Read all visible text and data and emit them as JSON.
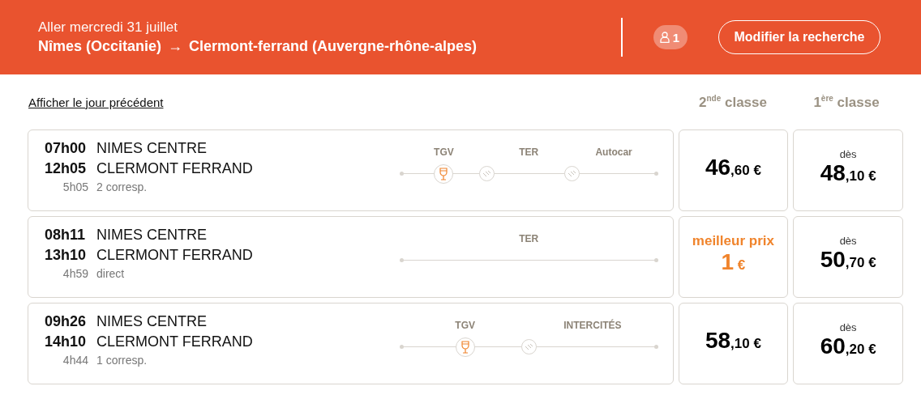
{
  "header": {
    "date": "Aller mercredi 31 juillet",
    "origin": "Nîmes (Occitanie)",
    "arrow": "→",
    "destination": "Clermont-ferrand (Auvergne-rhône-alpes)",
    "passengers": "1",
    "button": "Modifier la recherche"
  },
  "previous_day_link": "Afficher le jour précédent",
  "classes": [
    {
      "label": "2$^{nde}$ classe"
    },
    {
      "label": "1$^{ère}$ classe"
    }
  ],
  "trains": [
    {
      "departure": "07h00",
      "arrival": "12h05",
      "duration": "5h05",
      "origin": "NIMES CENTRE",
      "destination": "CLERMONT FERRAND",
      "connections": "2 corresp.",
      "segments": [
        {
          "label": "TGV",
          "bar_car": true
        },
        {
          "label": "TER",
          "bar_car": false
        },
        {
          "label": "Autocar",
          "bar_car": false
        }
      ],
      "prices": [
        {
          "best": false,
          "whole": "46",
          "fraction": ",60 €"
        },
        {
          "best": false,
          "from": "dès",
          "whole": "48",
          "fraction": ",10 €"
        }
      ]
    },
    {
      "departure": "08h11",
      "arrival": "13h10",
      "duration": "4h59",
      "origin": "NIMES CENTRE",
      "destination": "CLERMONT FERRAND",
      "connections": "direct",
      "segments": [
        {
          "label": "TER",
          "bar_car": false
        }
      ],
      "prices": [
        {
          "best": true,
          "tag": "meilleur prix",
          "whole": "1",
          "fraction": " €"
        },
        {
          "best": false,
          "from": "dès",
          "whole": "50",
          "fraction": ",70 €"
        }
      ]
    },
    {
      "departure": "09h26",
      "arrival": "14h10",
      "duration": "4h44",
      "origin": "NIMES CENTRE",
      "destination": "CLERMONT FERRAND",
      "connections": "1 corresp.",
      "segments": [
        {
          "label": "TGV",
          "bar_car": true
        },
        {
          "label": "INTERCITÉS",
          "bar_car": false
        }
      ],
      "prices": [
        {
          "best": false,
          "whole": "58",
          "fraction": ",10 €"
        },
        {
          "best": false,
          "from": "dès",
          "whole": "60",
          "fraction": ",20 €"
        }
      ]
    }
  ]
}
